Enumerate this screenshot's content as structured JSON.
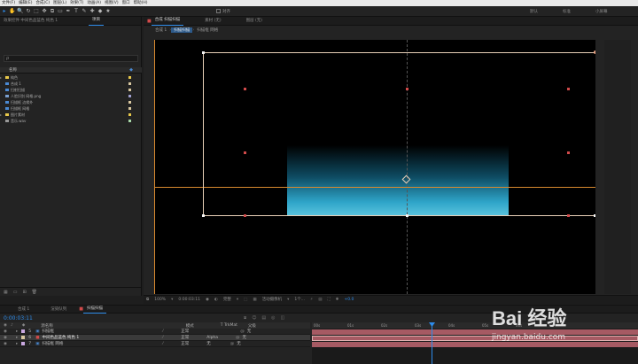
{
  "menu": [
    "文件(F)",
    "编辑(E)",
    "合成(C)",
    "图层(L)",
    "效果(T)",
    "动画(A)",
    "视图(V)",
    "窗口",
    "帮助(H)"
  ],
  "toolbar": {
    "tools": [
      "▸",
      "✋",
      "🔍",
      "↻",
      "⬚",
      "✥",
      "⧉",
      "▭",
      "✒",
      "T",
      "✎",
      "✚",
      "◆",
      "★"
    ],
    "snap_label": "对齐",
    "workspaces": [
      "默认",
      "标准",
      "小屏幕"
    ]
  },
  "left_panel": {
    "tabs": [
      "效果控件 中间色品蓝色 纯色 1",
      "项目"
    ],
    "search_placeholder": "ρ",
    "column_name": "名称",
    "items": [
      {
        "name": "纯色",
        "type": "folder",
        "color": "#e8c84a",
        "tag": "#e8c84a"
      },
      {
        "name": "合成 1",
        "type": "comp",
        "color": "#4a8ad4",
        "tag": "#d9c8a0"
      },
      {
        "name": "扫射扫描",
        "type": "comp",
        "color": "#4a8ad4",
        "tag": "#d9c8a0"
      },
      {
        "name": "人脸识别 网格.png",
        "type": "image",
        "color": "#7aa0d0",
        "tag": "#a0a0d0"
      },
      {
        "name": "扫描框 边缘外",
        "type": "comp",
        "color": "#4a8ad4",
        "tag": "#d9c8a0"
      },
      {
        "name": "扫描框 网格",
        "type": "comp",
        "color": "#4a8ad4",
        "tag": "#d9c8a0"
      },
      {
        "name": "图片素材",
        "type": "folder",
        "color": "#e8c84a",
        "tag": "#e8c84a"
      },
      {
        "name": "音乐.wav",
        "type": "audio",
        "color": "#999999",
        "tag": "#a8d8a8"
      }
    ]
  },
  "viewer": {
    "tabs": [
      "合成 扫描扫描",
      "素材 (无)",
      "图层 (无)"
    ],
    "breadcrumbs": [
      "合成 1",
      "扫描扫描",
      "扫描框 网格"
    ],
    "zoom": "100%",
    "timecode": "0:00:03:11",
    "quality": "完整",
    "camera": "活动摄像机",
    "views": "1个...",
    "exposure": "+0.0"
  },
  "timeline": {
    "tabs": [
      "合成 1",
      "渲染队列",
      "扫描扫描"
    ],
    "timecode": "0:00:03:11",
    "columns": [
      "源名称",
      "模式",
      "T TrkMat",
      "父级"
    ],
    "ruler": [
      "00s",
      "01s",
      "02s",
      "03s",
      "04s",
      "05s",
      "06s"
    ],
    "layers": [
      {
        "num": "5",
        "name": "扫描框",
        "mode": "正常",
        "trkmat": "",
        "parent": "无",
        "color": "#c9a8e0",
        "selected": false
      },
      {
        "num": "6",
        "name": "中间色品蓝色 纯色 1",
        "mode": "正常",
        "trkmat": "Alpha",
        "parent": "无",
        "color": "#d9c8a0",
        "selected": true
      },
      {
        "num": "7",
        "name": "扫描框 网格",
        "mode": "正常",
        "trkmat": "无",
        "parent": "无",
        "color": "#c9a8e0",
        "selected": false
      }
    ]
  },
  "watermark": {
    "text": "Bai 经验",
    "url": "jingyan.baidu.com"
  }
}
